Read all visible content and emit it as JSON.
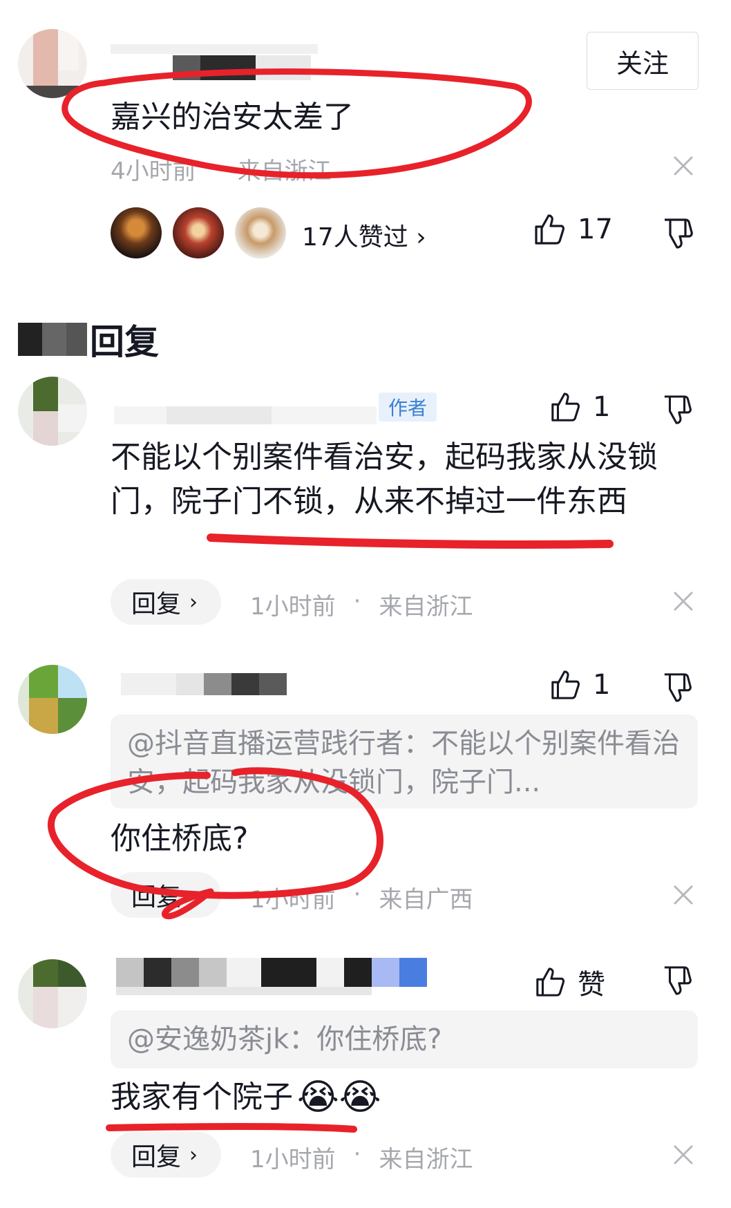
{
  "main_comment": {
    "follow_label": "关注",
    "text": "嘉兴的治安太差了",
    "time": "4小时前",
    "location": "来自浙江",
    "likers_text": "17人赞过 ›",
    "like_count": "17"
  },
  "replies_section": {
    "title": "回复"
  },
  "replies": [
    {
      "author_tag": "作者",
      "like_count": "1",
      "text": "不能以个别案件看治安，起码我家从没锁门，院子门不锁，从来不掉过一件东西",
      "reply_label": "回复",
      "time": "1小时前",
      "separator": "·",
      "location": "来自浙江"
    },
    {
      "like_count": "1",
      "quote": "@抖音直播运营践行者：不能以个别案件看治安，起码我家从没锁门，院子门...",
      "text": "你住桥底?",
      "reply_label": "回复",
      "time": "1小时前",
      "separator": "·",
      "location": "来自广西"
    },
    {
      "like_label": "赞",
      "quote": "@安逸奶茶jk：你住桥底?",
      "text": "我家有个院子",
      "emoji": "😭😭",
      "reply_label": "回复",
      "time": "1小时前",
      "separator": "·",
      "location": "来自浙江"
    }
  ],
  "colors": {
    "annotation_red": "#e8222a",
    "meta_gray": "#a5a7ad",
    "pill_bg": "#f3f3f4"
  }
}
